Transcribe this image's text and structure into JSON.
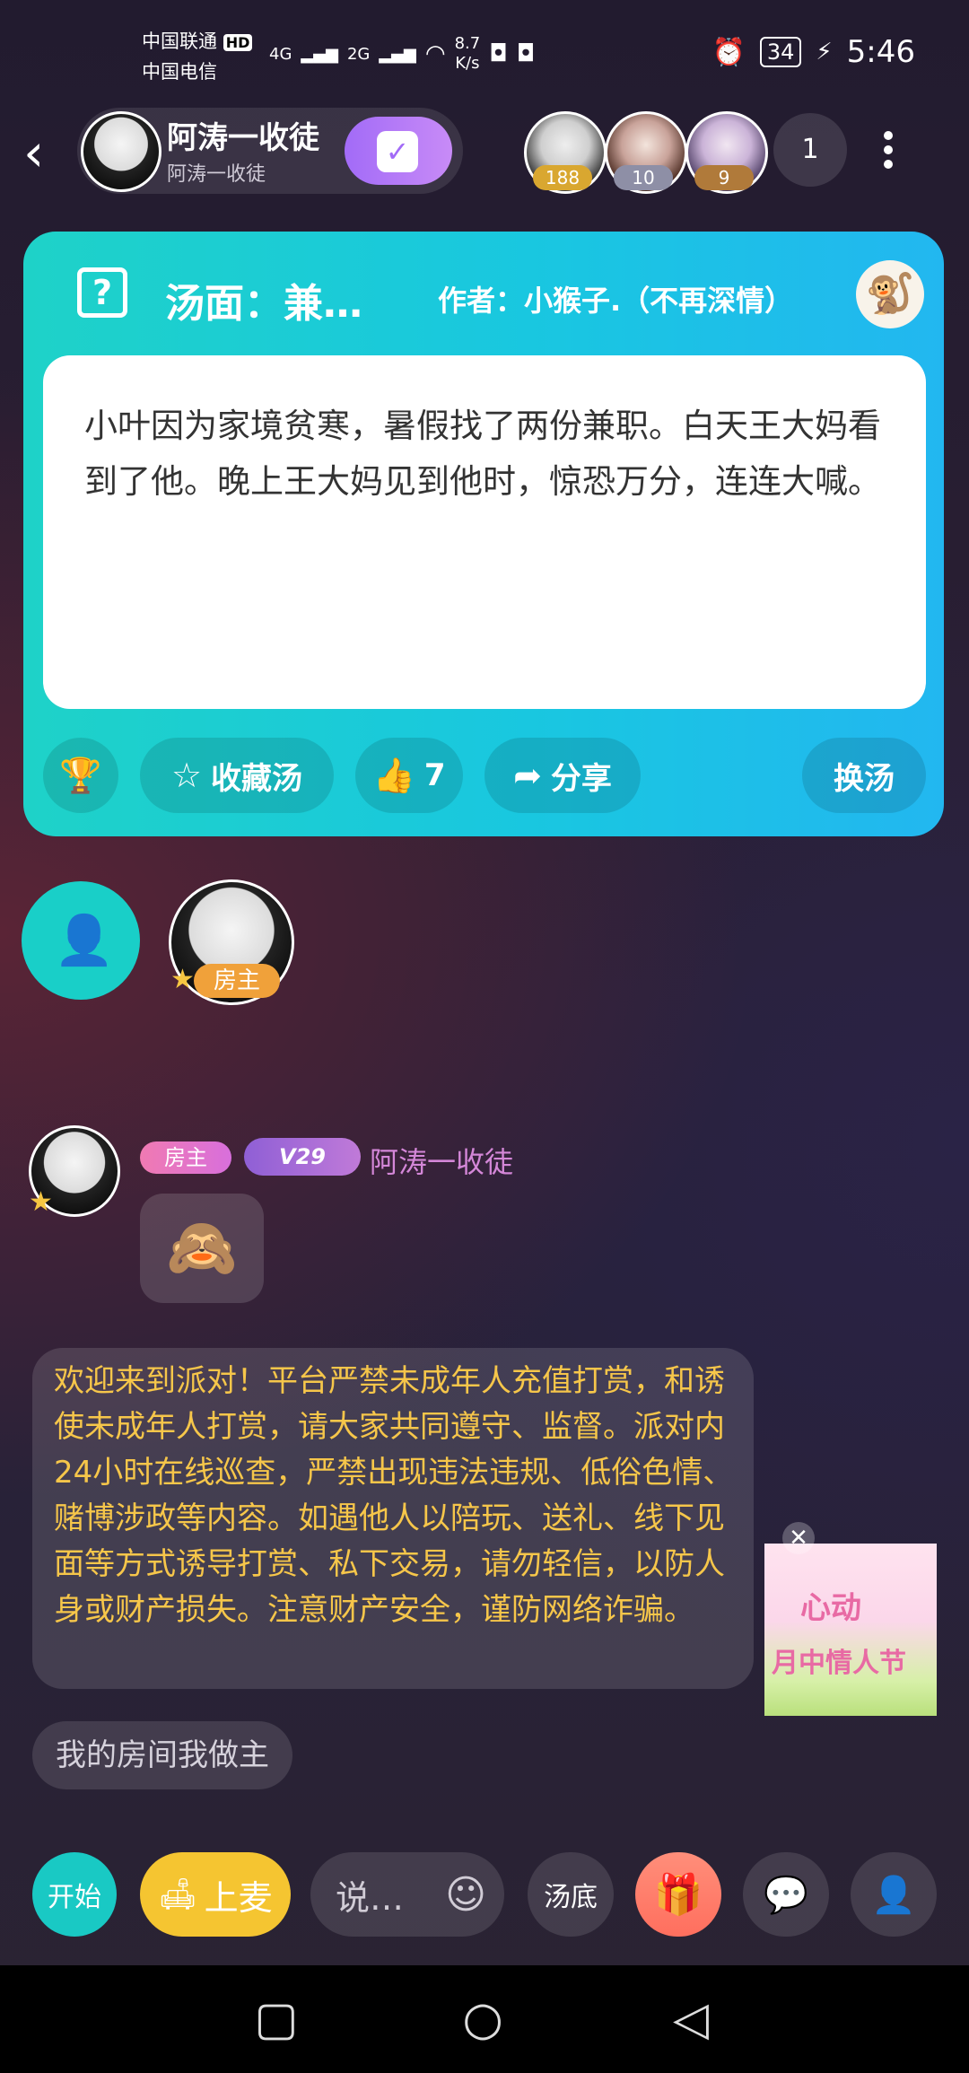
{
  "status_bar": {
    "carrier1": "中国联通",
    "carrier1_badge": "HD",
    "carrier2": "中国电信",
    "net1": "4G",
    "net2": "2G",
    "speed": "8.7",
    "speed_unit": "K/s",
    "battery": "34",
    "time": "5:46"
  },
  "header": {
    "host_name": "阿涛一收徒",
    "host_sub": "阿涛一收徒",
    "viewers": [
      {
        "badge": "188",
        "badge_color": "#d9a730"
      },
      {
        "badge": "10",
        "badge_color": "#8e8fa6"
      },
      {
        "badge": "9",
        "badge_color": "#b07a3a"
      }
    ],
    "viewer_count": "1"
  },
  "card": {
    "title": "汤面：兼…",
    "author": "作者：小猴子.（不再深情）",
    "story": "小叶因为家境贫寒，暑假找了两份兼职。白天王大妈看到了他。晚上王大妈见到他时，惊恐万分，连连大喊。",
    "favorite_label": "收藏汤",
    "like_count": "7",
    "share_label": "分享",
    "change_label": "换汤"
  },
  "seat": {
    "host_tag": "房主"
  },
  "chat": {
    "tag_host": "房主",
    "tag_vip": "V29",
    "sender_name": "阿涛一收徒",
    "notice": "欢迎来到派对！平台严禁未成年人充值打赏，和诱使未成年人打赏，请大家共同遵守、监督。派对内24小时在线巡查，严禁出现违法违规、低俗色情、赌博涉政等内容。如遇他人以陪玩、送礼、线下见面等方式诱导打赏、私下交易，请勿轻信，以防人身或财产损失。注意财产安全，谨防网络诈骗。",
    "welcome": "我的房间我做主"
  },
  "promo": {
    "line1": "心动",
    "line2": "月中情人节"
  },
  "toolbar": {
    "start": "开始",
    "mic": "上麦",
    "input_placeholder": "说…",
    "soup_bottom": "汤底"
  },
  "icons": {
    "back": "back-arrow-icon",
    "checkin": "calendar-check-icon",
    "more": "more-vertical-icon",
    "help": "question-icon",
    "trophy": "trophy-icon",
    "star": "star-icon",
    "like": "thumbs-up-icon",
    "share": "share-arrow-icon",
    "add_user": "add-user-icon",
    "emoji": "smile-icon",
    "gift": "gift-icon",
    "message": "message-icon",
    "invite": "user-plus-icon"
  },
  "colors": {
    "card_gradient_start": "#1ed2c8",
    "card_gradient_end": "#22b7f0",
    "notice_text": "#f6c64a",
    "mic_button": "#f5c531",
    "host_name_chat": "#d487d8"
  }
}
